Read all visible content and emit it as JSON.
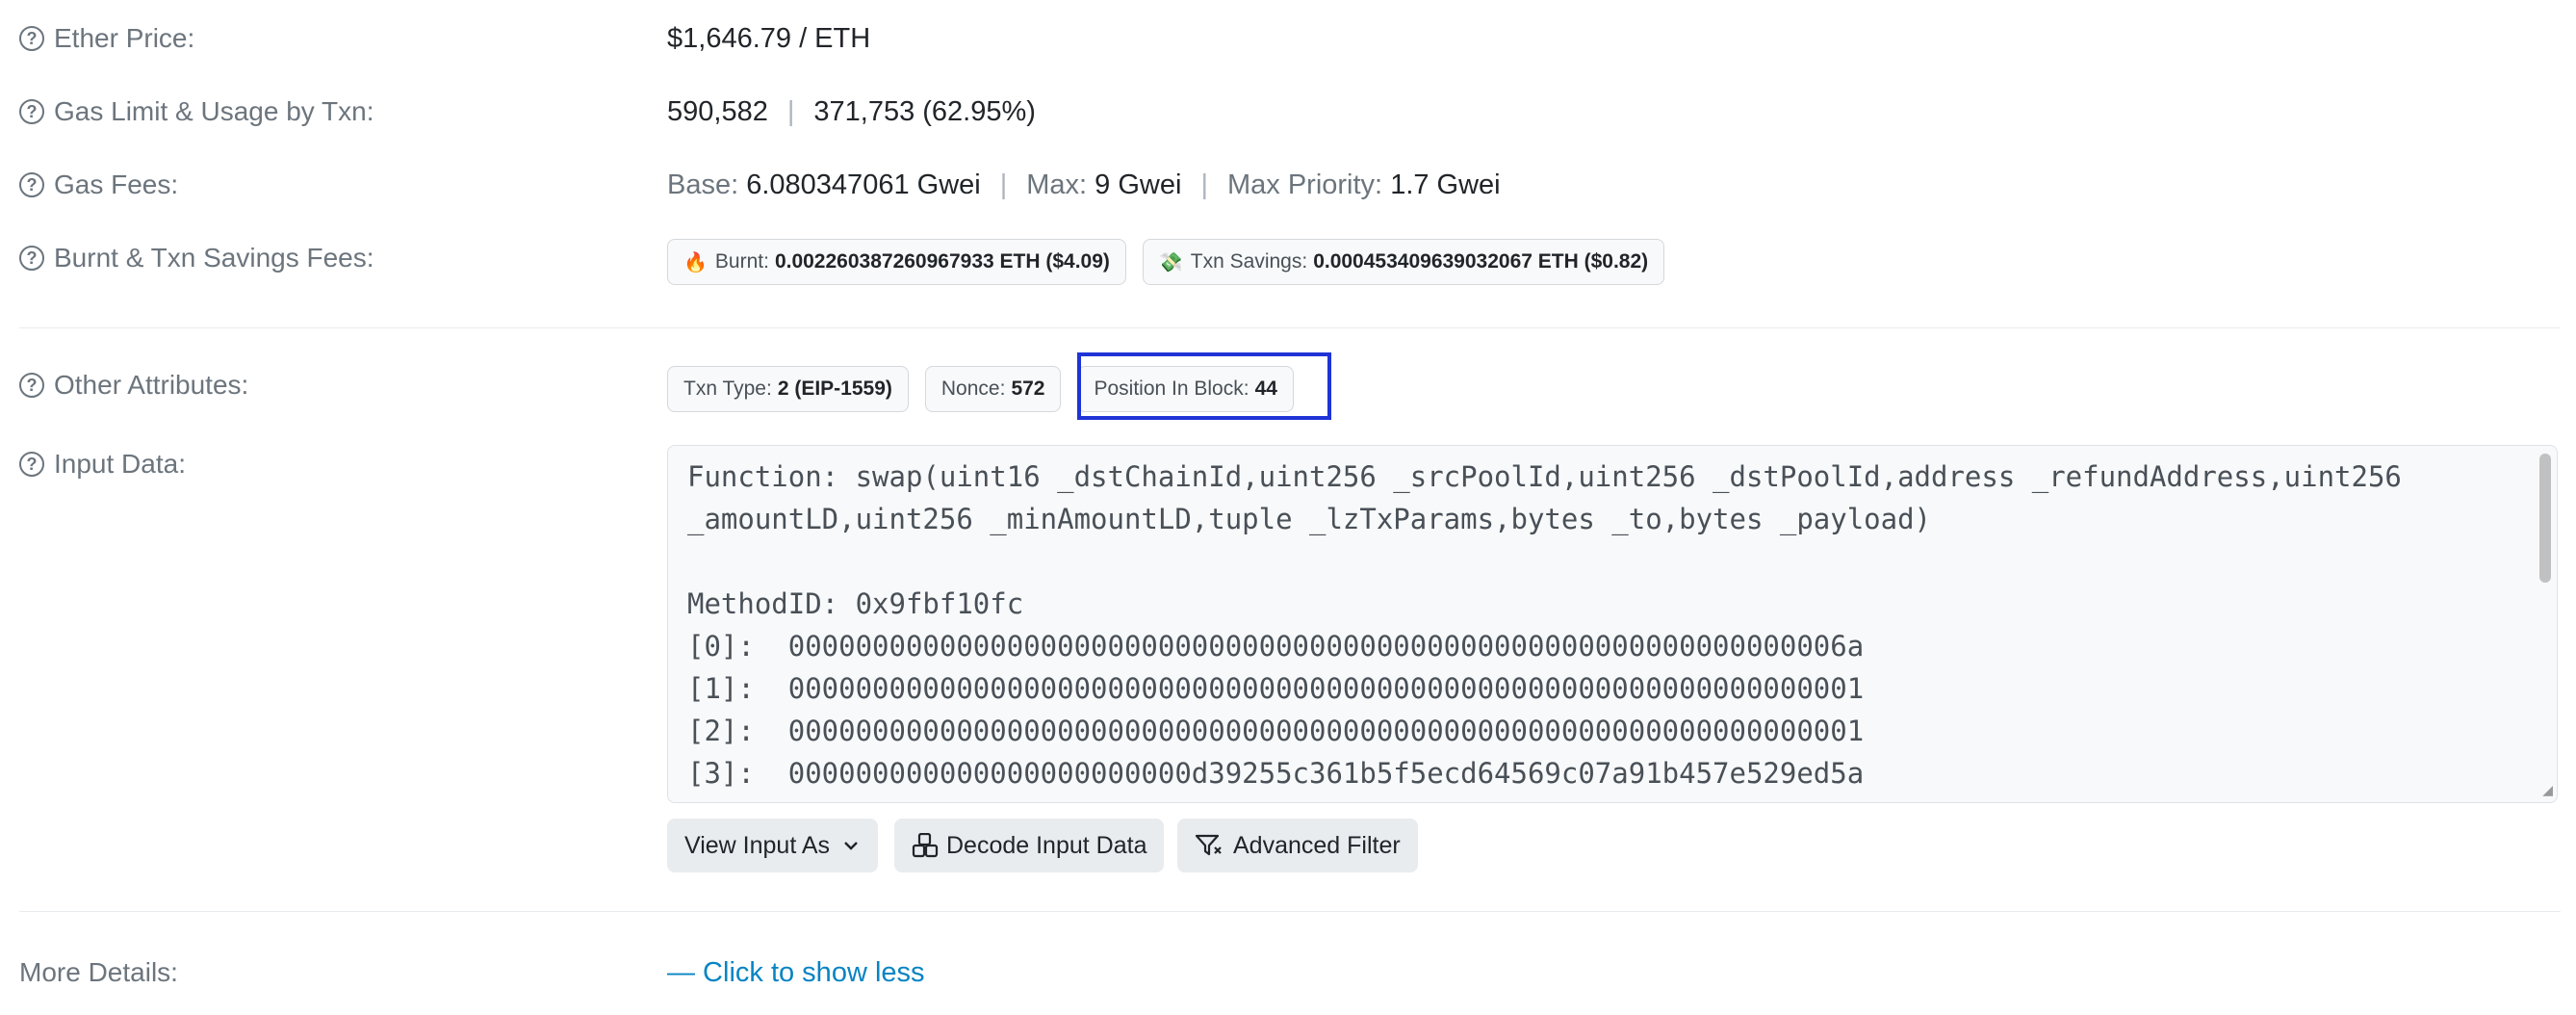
{
  "rows": {
    "ether_price": {
      "label": "Ether Price:",
      "value": "$1,646.79 / ETH"
    },
    "gas_limit": {
      "label": "Gas Limit & Usage by Txn:",
      "limit": "590,582",
      "sep": "|",
      "usage": "371,753 (62.95%)"
    },
    "gas_fees": {
      "label": "Gas Fees:",
      "base_label": "Base:",
      "base_value": "6.080347061 Gwei",
      "max_label": "Max:",
      "max_value": "9 Gwei",
      "priority_label": "Max Priority:",
      "priority_value": "1.7 Gwei",
      "sep": "|"
    },
    "burnt": {
      "label": "Burnt & Txn Savings Fees:",
      "burnt_icon": "🔥",
      "burnt_label": "Burnt:",
      "burnt_value": "0.002260387260967933 ETH ($4.09)",
      "savings_icon": "💸",
      "savings_label": "Txn Savings:",
      "savings_value": "0.000453409639032067 ETH ($0.82)"
    },
    "other": {
      "label": "Other Attributes:",
      "txn_type_label": "Txn Type:",
      "txn_type_value": "2 (EIP-1559)",
      "nonce_label": "Nonce:",
      "nonce_value": "572",
      "position_label": "Position In Block:",
      "position_value": "44"
    },
    "input": {
      "label": "Input Data:",
      "lines": [
        "Function: swap(uint16 _dstChainId,uint256 _srcPoolId,uint256 _dstPoolId,address _refundAddress,uint256",
        "_amountLD,uint256 _minAmountLD,tuple _lzTxParams,bytes _to,bytes _payload)",
        "",
        "MethodID: 0x9fbf10fc",
        "[0]:  000000000000000000000000000000000000000000000000000000000000006a",
        "[1]:  0000000000000000000000000000000000000000000000000000000000000001",
        "[2]:  0000000000000000000000000000000000000000000000000000000000000001",
        "[3]:  000000000000000000000000d39255c361b5f5ecd64569c07a91b457e529ed5a"
      ]
    },
    "more": {
      "label": "More Details:",
      "link": "— Click to show less"
    }
  },
  "buttons": {
    "view_input": "View Input As",
    "decode": "Decode Input Data",
    "advanced": "Advanced Filter"
  },
  "colors": {
    "highlight": "#1f33d6",
    "link": "#0784c3"
  }
}
